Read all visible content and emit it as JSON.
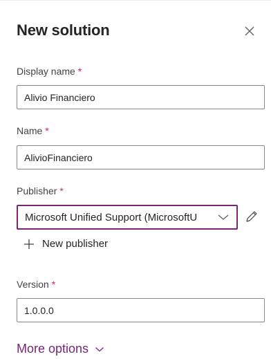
{
  "panel": {
    "title": "New solution"
  },
  "display_name": {
    "label": "Display name",
    "required_mark": "*",
    "value": "Alivio Financiero"
  },
  "name": {
    "label": "Name",
    "required_mark": "*",
    "value": "AlivioFinanciero"
  },
  "publisher": {
    "label": "Publisher",
    "required_mark": "*",
    "selected": "Microsoft Unified Support (MicrosoftU"
  },
  "new_publisher": {
    "label": "New publisher"
  },
  "version": {
    "label": "Version",
    "required_mark": "*",
    "value": "1.0.0.0"
  },
  "more_options": {
    "label": "More options"
  },
  "colors": {
    "accent": "#742774",
    "required": "#c4314b",
    "border": "#8a8886",
    "text": "#242424"
  },
  "icons": {
    "close": "close-icon",
    "chevron": "chevron-down-icon",
    "edit": "pencil-icon",
    "add": "plus-icon"
  }
}
